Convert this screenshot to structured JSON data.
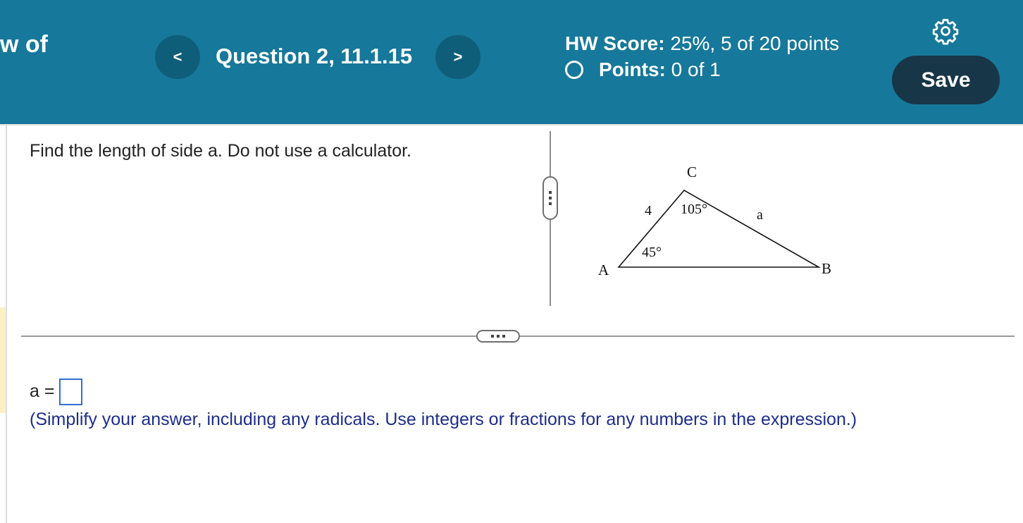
{
  "header": {
    "left_text": "w of",
    "prev_label": "<",
    "question_title": "Question 2, 11.1.15",
    "next_label": ">",
    "hw_score_label": "HW Score:",
    "hw_score_value": "25%, 5 of 20 points",
    "points_label": "Points:",
    "points_value": "0 of 1",
    "settings_icon": "gear-icon",
    "save_label": "Save"
  },
  "question": {
    "prompt": "Find the length of side a. Do not use a calculator."
  },
  "figure": {
    "vertex_a": "A",
    "vertex_b": "B",
    "vertex_c": "C",
    "side_ac": "4",
    "side_a": "a",
    "angle_a": "45°",
    "angle_c": "105°"
  },
  "answer": {
    "label": "a =",
    "value": "",
    "instructions": "(Simplify your answer, including any radicals. Use integers or fractions for any numbers in the expression.)"
  },
  "colors": {
    "header_bg": "#16789a",
    "nav_btn_bg": "#0f5e79",
    "save_btn_bg": "#173647",
    "instructions_text": "#1d2d8c",
    "answer_box_border": "#2f6fd6"
  }
}
